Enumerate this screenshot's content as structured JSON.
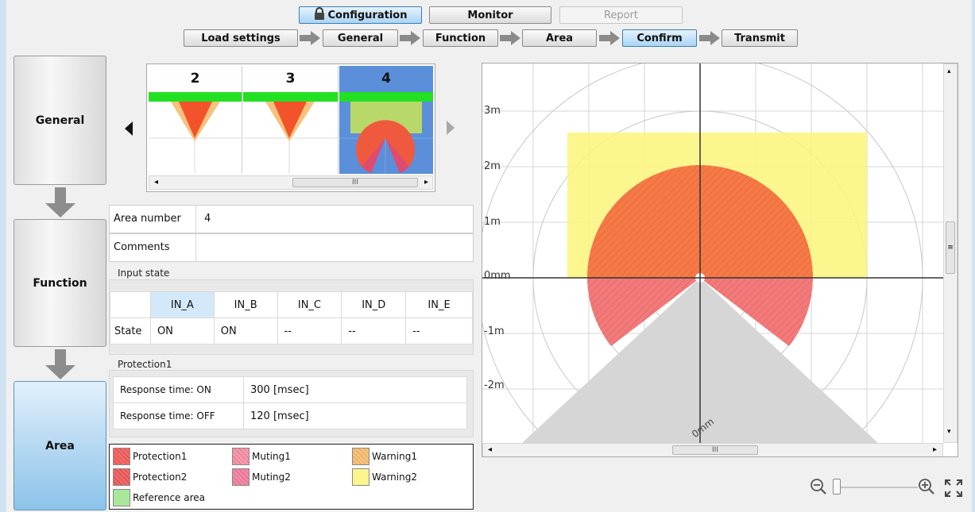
{
  "top_tabs": {
    "configuration": "Configuration",
    "monitor": "Monitor",
    "report": "Report"
  },
  "steps": [
    "Load settings",
    "General",
    "Function",
    "Area",
    "Confirm",
    "Transmit"
  ],
  "left_nav": [
    "General",
    "Function",
    "Area"
  ],
  "thumbnails": [
    {
      "label": "2"
    },
    {
      "label": "3"
    },
    {
      "label": "4",
      "selected": true
    }
  ],
  "thumb_scroll": "III",
  "area_number_label": "Area number",
  "area_number_value": "4",
  "comments_label": "Comments",
  "comments_value": "",
  "input_state": {
    "title": "Input state",
    "headers": [
      "IN_A",
      "IN_B",
      "IN_C",
      "IN_D",
      "IN_E"
    ],
    "row_label": "State",
    "values": [
      "ON",
      "ON",
      "--",
      "--",
      "--"
    ]
  },
  "protection": {
    "title": "Protection1",
    "rows": [
      {
        "label": "Response time: ON",
        "value": "300 [msec]"
      },
      {
        "label": "Response time: OFF",
        "value": "120 [msec]"
      }
    ]
  },
  "legend": [
    {
      "label": "Protection1",
      "color": "#f26b6b"
    },
    {
      "label": "Muting1",
      "color": "#f59aae"
    },
    {
      "label": "Warning1",
      "color": "#f7c27d"
    },
    {
      "label": "Protection2",
      "color": "#ef6a6a"
    },
    {
      "label": "Muting2",
      "color": "#f28aa6"
    },
    {
      "label": "Warning2",
      "color": "#fbf58c"
    },
    {
      "label": "Reference area",
      "color": "#a9e79c"
    }
  ],
  "area_view": {
    "y_labels": [
      "3m",
      "2m",
      "1m",
      "0mm",
      "-1m",
      "-2m"
    ],
    "center_label": "0mm",
    "hscroll": "III",
    "vscroll": "≡"
  },
  "colors": {
    "accent": "#3c7fb1",
    "protection": "#f26b45",
    "muting": "#f5899a",
    "warning": "#fbf57a",
    "reference": "#22e022",
    "shadow": "#d4d4d4"
  }
}
